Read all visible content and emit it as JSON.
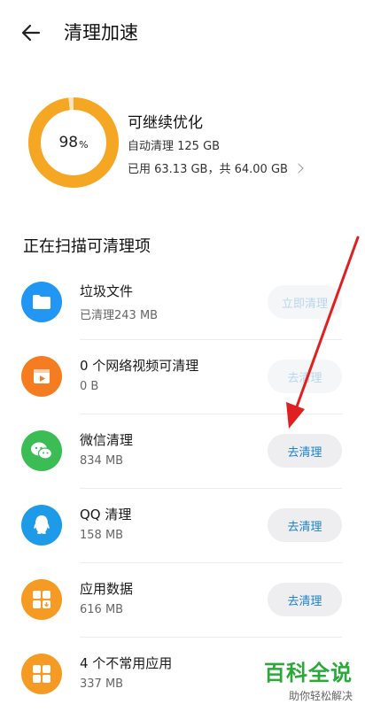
{
  "header": {
    "title": "清理加速"
  },
  "summary": {
    "percent": "98",
    "percent_unit": "%",
    "percent_value": 0.98,
    "title": "可继续优化",
    "line1": "自动清理 125 GB",
    "line2": "已用 63.13 GB，共 64.00 GB",
    "ring_color": "#f5a623"
  },
  "section": {
    "title": "正在扫描可清理项"
  },
  "items": [
    {
      "name": "垃圾文件",
      "size": "已清理243 MB",
      "button": "立即清理",
      "icon": "folder-icon",
      "color": "#2196f3"
    },
    {
      "name": "0 个网络视频可清理",
      "size": "0 B",
      "button": "去清理",
      "icon": "video-icon",
      "color": "#f57c20"
    },
    {
      "name": "微信清理",
      "size": "834 MB",
      "button": "去清理",
      "icon": "wechat-icon",
      "color": "#3cbc55"
    },
    {
      "name": "QQ 清理",
      "size": "158 MB",
      "button": "去清理",
      "icon": "qq-icon",
      "color": "#1e9be8"
    },
    {
      "name": "应用数据",
      "size": "616 MB",
      "button": "去清理",
      "icon": "app-data-icon",
      "color": "#f59a23"
    },
    {
      "name": "4 个不常用应用",
      "size": "337 MB",
      "button": "",
      "icon": "apps-icon",
      "color": "#f59a23"
    }
  ],
  "watermark": {
    "main": "百科全说",
    "sub": "助你轻松解决"
  },
  "annotation_color": "#e02020"
}
